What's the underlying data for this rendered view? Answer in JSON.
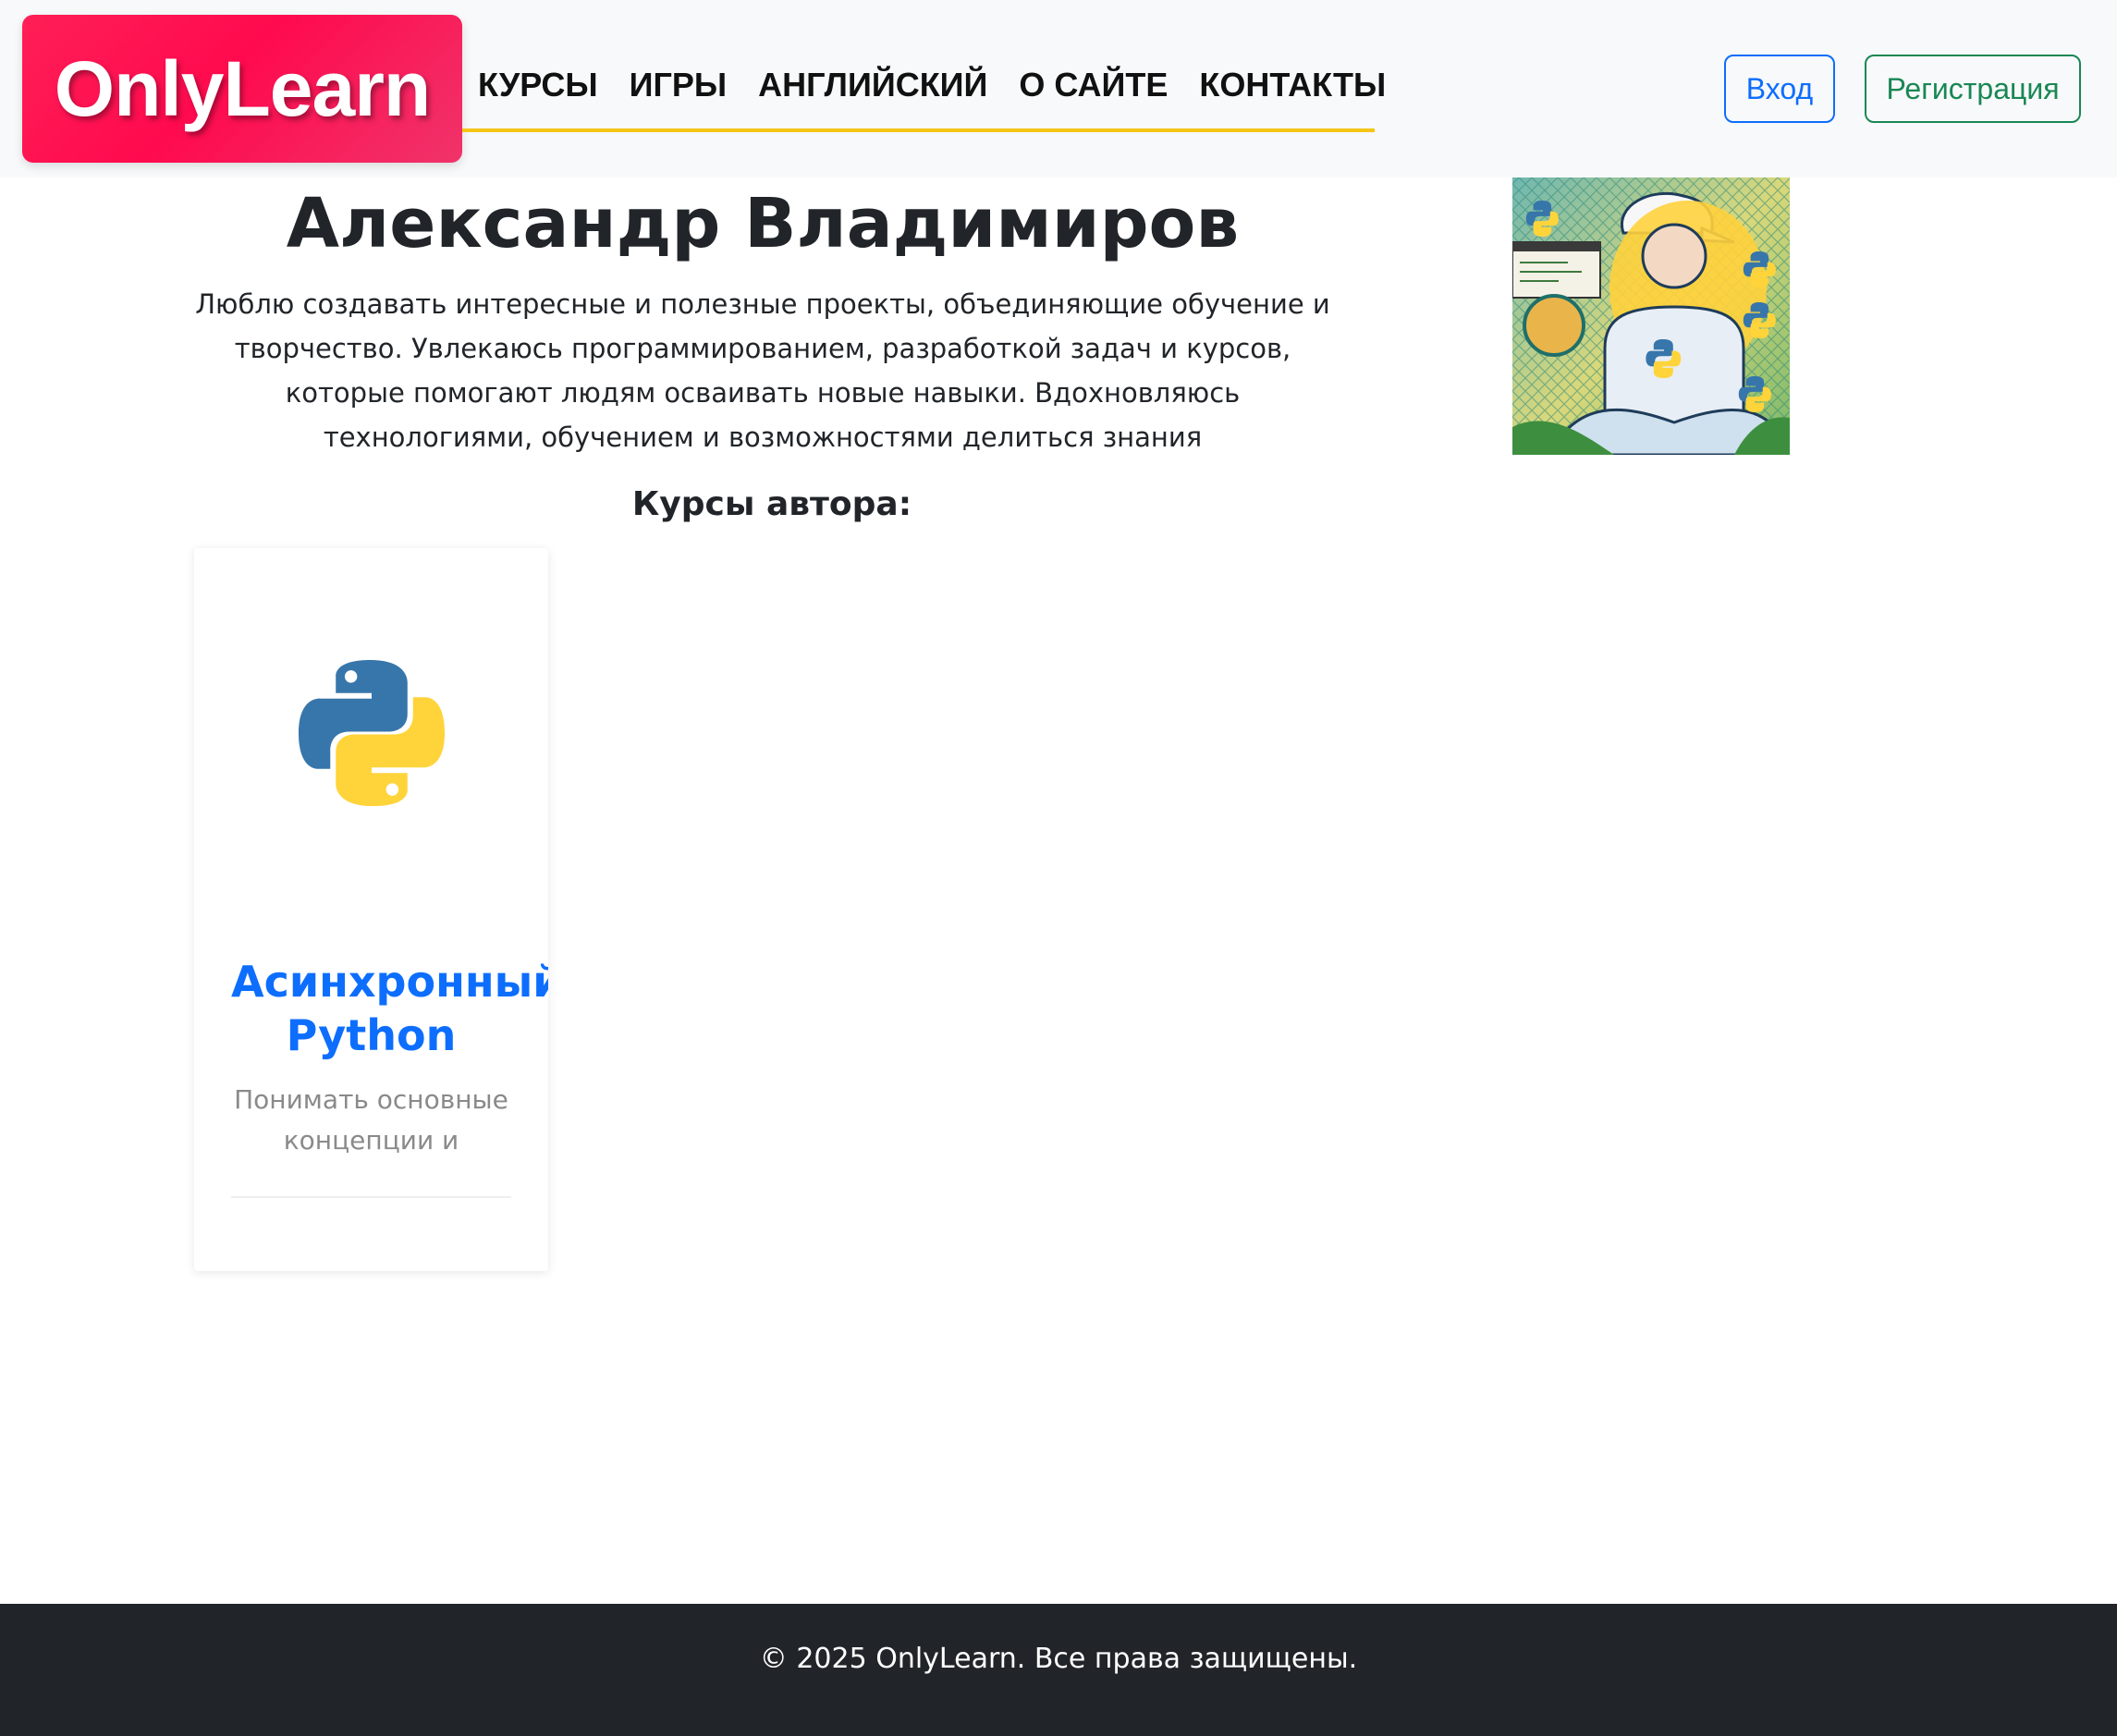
{
  "header": {
    "logo_text": "OnlyLearn",
    "nav": [
      {
        "label": "КУРСЫ"
      },
      {
        "label": "ИГРЫ"
      },
      {
        "label": "АНГЛИЙСКИЙ"
      },
      {
        "label": "О САЙТЕ"
      },
      {
        "label": "КОНТАКТЫ"
      }
    ],
    "login_label": "Вход",
    "register_label": "Регистрация"
  },
  "author": {
    "name": "Александр Владимиров",
    "bio": "Люблю создавать интересные и полезные проекты, объединяющие обучение и творчество. Увлекаюсь программированием, разработкой задач и курсов, которые помогают людям осваивать новые навыки. Вдохновляюсь технологиями, обучением и возможностями делиться знания",
    "courses_heading": "Курсы автора:"
  },
  "courses": [
    {
      "title": "Асинхронный Python",
      "description": "Понимать основные концепции и",
      "icon": "python-logo-icon"
    }
  ],
  "footer": {
    "copyright": "© 2025 OnlyLearn. Все права защищены."
  },
  "colors": {
    "brand": "#ff1f57",
    "nav_underline": "#f5c518",
    "primary": "#0d6efd",
    "success": "#198754",
    "footer_bg": "#212529",
    "python_blue": "#3776ab",
    "python_yellow": "#ffd43b"
  }
}
